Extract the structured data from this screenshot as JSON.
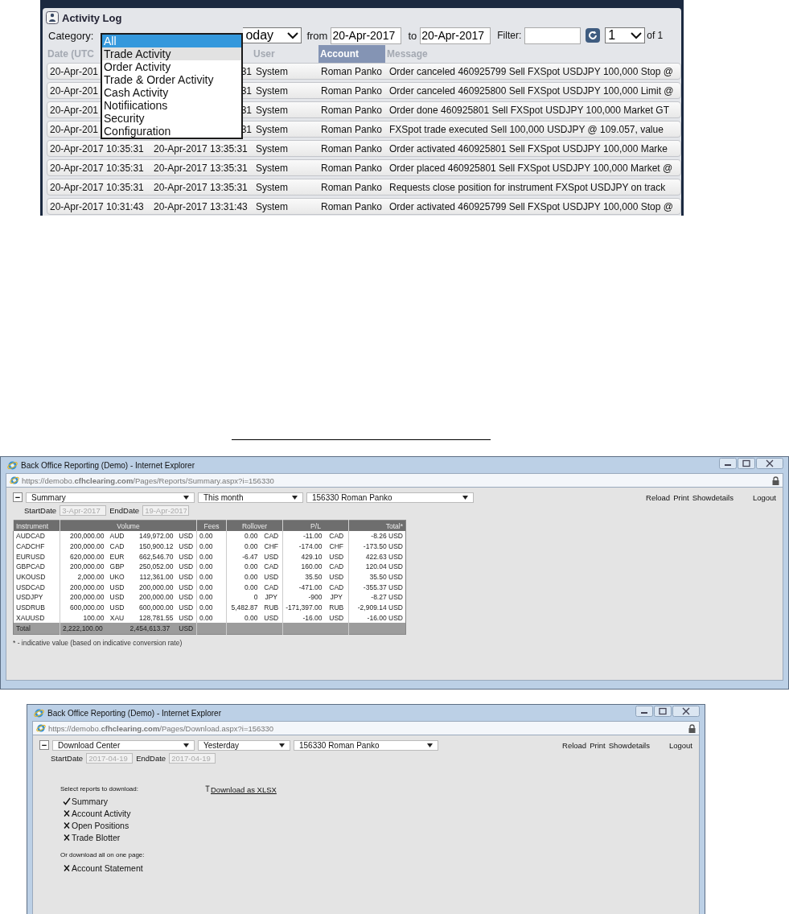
{
  "activity_log": {
    "title": "Activity Log",
    "category_label": "Category:",
    "period_select": "oday",
    "from_label": "from",
    "from_date": "20-Apr-2017",
    "to_label": "to",
    "to_date": "20-Apr-2017",
    "filter_label": "Filter:",
    "page_select": "1",
    "page_count": "of 1",
    "columns": [
      {
        "label": "Date (UTC",
        "sorted": false
      },
      {
        "sorted": false
      },
      {
        "label": "User",
        "sorted": false
      },
      {
        "label": "Account",
        "sorted": true
      },
      {
        "label": "Message",
        "sorted": false
      }
    ],
    "rows": [
      [
        "20-Apr-201",
        "31",
        "System",
        "Roman Panko",
        "Order canceled 460925799 Sell FXSpot USDJPY 100,000 Stop @"
      ],
      [
        "20-Apr-201",
        "31",
        "System",
        "Roman Panko",
        "Order canceled 460925800 Sell FXSpot USDJPY 100,000 Limit @"
      ],
      [
        "20-Apr-201",
        "31",
        "System",
        "Roman Panko",
        "Order done 460925801 Sell FXSpot USDJPY 100,000 Market GT"
      ],
      [
        "20-Apr-201",
        "31",
        "System",
        "Roman Panko",
        "FXSpot trade executed Sell 100,000 USDJPY @ 109.057, value"
      ],
      [
        "20-Apr-2017 10:35:31",
        "20-Apr-2017 13:35:31",
        "System",
        "Roman Panko",
        "Order activated 460925801 Sell FXSpot USDJPY 100,000 Marke"
      ],
      [
        "20-Apr-2017 10:35:31",
        "20-Apr-2017 13:35:31",
        "System",
        "Roman Panko",
        "Order placed 460925801 Sell FXSpot USDJPY 100,000 Market @"
      ],
      [
        "20-Apr-2017 10:35:31",
        "20-Apr-2017 13:35:31",
        "System",
        "Roman Panko",
        "Requests close position for instrument FXSpot USDJPY on track"
      ],
      [
        "20-Apr-2017 10:31:43",
        "20-Apr-2017 13:31:43",
        "System",
        "Roman Panko",
        "Order activated 460925799 Sell FXSpot USDJPY 100,000 Stop @"
      ]
    ],
    "category_dropdown": [
      {
        "label": "All",
        "selected": true,
        "hovered": false
      },
      {
        "label": "Trade Activity",
        "selected": false,
        "hovered": true
      },
      {
        "label": "Order Activity",
        "selected": false,
        "hovered": false
      },
      {
        "label": "Trade & Order Activity",
        "selected": false,
        "hovered": false
      },
      {
        "label": "Cash Activity",
        "selected": false,
        "hovered": false
      },
      {
        "label": "Notifiications",
        "selected": false,
        "hovered": false
      },
      {
        "label": "Security",
        "selected": false,
        "hovered": false
      },
      {
        "label": "Configuration",
        "selected": false,
        "hovered": false
      }
    ]
  },
  "windows": [
    {
      "kind": "summary",
      "title": "Back Office Reporting (Demo) - Internet Explorer",
      "address": "https://demobo.**cfhclearing.com**/Pages/Reports/Summary.aspx?i=156330",
      "collapse_button": "−",
      "report_select": "Summary",
      "period_select": "This month",
      "account_select": "156330 Roman Panko",
      "links": [
        "Reload",
        "Print",
        "Showdetails",
        "Logout"
      ],
      "start_label": "StartDate",
      "start_date": "3-Apr-2017",
      "end_label": "EndDate",
      "end_date": "19-Apr-2017",
      "table": {
        "columns": [
          "Instrument",
          "Volume",
          "Fees",
          "Rollover",
          "P/L",
          "Total*"
        ],
        "rows": [
          [
            "AUDCAD",
            [
              "200,000.00",
              "AUD",
              "149,972.00",
              "USD"
            ],
            "0.00",
            [
              "0.00",
              "CAD"
            ],
            [
              "-11.00",
              "CAD"
            ],
            "-8.26 USD"
          ],
          [
            "CADCHF",
            [
              "200,000.00",
              "CAD",
              "150,900.12",
              "USD"
            ],
            "0.00",
            [
              "0.00",
              "CHF"
            ],
            [
              "-174.00",
              "CHF"
            ],
            "-173.50 USD"
          ],
          [
            "EURUSD",
            [
              "620,000.00",
              "EUR",
              "662,546.70",
              "USD"
            ],
            "0.00",
            [
              "-6.47",
              "USD"
            ],
            [
              "429.10",
              "USD"
            ],
            "422.63 USD"
          ],
          [
            "GBPCAD",
            [
              "200,000.00",
              "GBP",
              "250,052.00",
              "USD"
            ],
            "0.00",
            [
              "0.00",
              "CAD"
            ],
            [
              "160.00",
              "CAD"
            ],
            "120.04 USD"
          ],
          [
            "UKOUSD",
            [
              "2,000.00",
              "UKO",
              "112,361.00",
              "USD"
            ],
            "0.00",
            [
              "0.00",
              "USD"
            ],
            [
              "35.50",
              "USD"
            ],
            "35.50 USD"
          ],
          [
            "USDCAD",
            [
              "200,000.00",
              "USD",
              "200,000.00",
              "USD"
            ],
            "0.00",
            [
              "0.00",
              "CAD"
            ],
            [
              "-471.00",
              "CAD"
            ],
            "-355.37 USD"
          ],
          [
            "USDJPY",
            [
              "200,000.00",
              "USD",
              "200,000.00",
              "USD"
            ],
            "0.00",
            [
              "0",
              "JPY"
            ],
            [
              "-900",
              "JPY"
            ],
            "-8.27 USD"
          ],
          [
            "USDRUB",
            [
              "600,000.00",
              "USD",
              "600,000.00",
              "USD"
            ],
            "0.00",
            [
              "5,482.87",
              "RUB"
            ],
            [
              "-171,397.00",
              "RUB"
            ],
            "-2,909.14 USD"
          ],
          [
            "XAUUSD",
            [
              "100.00",
              "XAU",
              "128,781.55",
              "USD"
            ],
            "0.00",
            [
              "0.00",
              "USD"
            ],
            [
              "-16.00",
              "USD"
            ],
            "-16.00 USD"
          ]
        ],
        "total": {
          "label": "Total",
          "volume_base": "2,222,100.00",
          "volume_quote": "2,454,613.37",
          "quote_currency": "USD"
        }
      },
      "footnote": "* - indicative value (based on indicative conversion rate)"
    },
    {
      "kind": "download",
      "title": "Back Office Reporting (Demo) - Internet Explorer",
      "address": "https://demobo.**cfhclearing.com**/Pages/Download.aspx?i=156330",
      "collapse_button": "−",
      "report_select": "Download Center",
      "period_select": "Yesterday",
      "account_select": "156330 Roman Panko",
      "links": [
        "Reload",
        "Print",
        "Showdetails",
        "Logout"
      ],
      "start_label": "StartDate",
      "start_date": "2017-04-19",
      "end_label": "EndDate",
      "end_date": "2017-04-19",
      "select_prompt": "Select reports to download:",
      "download_link": "Download as XLSX",
      "reports": [
        {
          "label": "Summary",
          "checked": true
        },
        {
          "label": "Account Activity",
          "checked": false
        },
        {
          "label": "Open Positions",
          "checked": false
        },
        {
          "label": "Trade Blotter",
          "checked": false
        }
      ],
      "all_prompt": "Or download all on one page:",
      "statement": [
        {
          "label": "Account Statement",
          "checked": false
        }
      ]
    }
  ]
}
